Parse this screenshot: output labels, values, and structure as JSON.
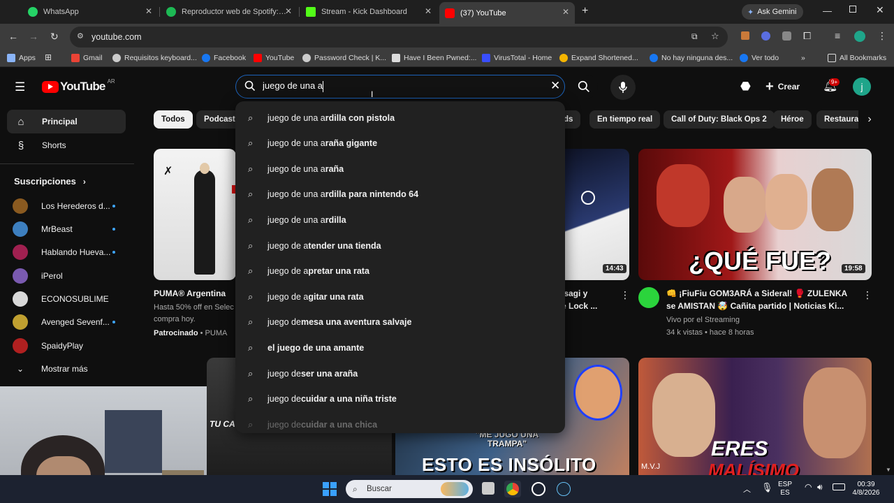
{
  "browser": {
    "tabs": [
      {
        "title": "WhatsApp",
        "fav_color": "#25d366"
      },
      {
        "title": "Reproductor web de Spotify: m",
        "fav_color": "#1db954"
      },
      {
        "title": "Stream - Kick Dashboard",
        "fav_color": "#53fc18"
      },
      {
        "title": "(37) YouTube",
        "fav_color": "#ff0000"
      }
    ],
    "ask_gemini": "Ask Gemini",
    "url": "youtube.com",
    "bookmarks": [
      {
        "label": "Apps"
      },
      {
        "label": "Gmail"
      },
      {
        "label": "Requisitos keyboard..."
      },
      {
        "label": "Facebook"
      },
      {
        "label": "YouTube"
      },
      {
        "label": "Password Check | K..."
      },
      {
        "label": "Have I Been Pwned:..."
      },
      {
        "label": "VirusTotal - Home"
      },
      {
        "label": "Expand Shortened..."
      },
      {
        "label": "No hay ninguna des..."
      },
      {
        "label": "Ver todo"
      }
    ],
    "all_bookmarks": "All Bookmarks"
  },
  "header": {
    "logo_text": "YouTube",
    "country": "AR",
    "search_value": "juego de una a",
    "create_label": "Crear",
    "notif_badge": "9+",
    "avatar_letter": "j"
  },
  "sidebar": {
    "principal": "Principal",
    "shorts": "Shorts",
    "subs_heading": "Suscripciones",
    "subs": [
      {
        "name": "Los Herederos d...",
        "color": "#8a5a20"
      },
      {
        "name": "MrBeast",
        "color": "#3d7fbf"
      },
      {
        "name": "Hablando Hueva...",
        "color": "#a02050"
      },
      {
        "name": "iPerol",
        "color": "#7a5ab0"
      },
      {
        "name": "ECONOSUBLIME",
        "color": "#d8d8d8"
      },
      {
        "name": "Avenged Sevenf...",
        "color": "#c0a030"
      },
      {
        "name": "SpaidyPlay",
        "color": "#b02020"
      }
    ],
    "show_more": "Mostrar más"
  },
  "chips": [
    "Todos",
    "Podcasts",
    "nds",
    "En tiempo real",
    "Call of Duty: Black Ops 2",
    "Héroe",
    "Restaurar"
  ],
  "suggestions": [
    {
      "typed": "juego de una a",
      "rest": "rdilla con pistola"
    },
    {
      "typed": "juego de una a",
      "rest": "raña gigante"
    },
    {
      "typed": "juego de una a",
      "rest": "raña"
    },
    {
      "typed": "juego de una a",
      "rest": "rdilla para nintendo 64"
    },
    {
      "typed": "juego de una a",
      "rest": "rdilla"
    },
    {
      "typed": "juego de a",
      "rest": "tender una tienda"
    },
    {
      "typed": "juego de a",
      "rest": "pretar una rata"
    },
    {
      "typed": "juego de a",
      "rest": "gitar una rata"
    },
    {
      "typed": "juego de ",
      "rest": "mesa una aventura salvaje"
    },
    {
      "typed": "",
      "rest": "el juego de una amante"
    },
    {
      "typed": "juego de ",
      "rest": "ser una araña"
    },
    {
      "typed": "juego de ",
      "rest": "cuidar a una niña triste"
    },
    {
      "typed": "juego de ",
      "rest": "cuidar a una chica"
    }
  ],
  "videos": {
    "ad": {
      "title": "PUMA® Argentina",
      "desc": "Hasta 50% off en Selec compra hoy.",
      "sponsored": "Patrocinado",
      "brand": "PUMA"
    },
    "v2": {
      "title_part1": "Isagi y",
      "title_part2": "e Lock ...",
      "duration": "14:43"
    },
    "v3": {
      "title": "👊 ¡FiuFiu GOM3ARÁ a Sideral! 🥊 ZULENKA se AMISTAN 🤯 Cañita partido | Noticias Ki...",
      "channel": "Vivo por el Streaming",
      "stats": "34 k vistas • hace 8 horas",
      "duration": "19:58",
      "overlay": "¿QUÉ FUE?"
    },
    "row2": {
      "left_text": "TU CA",
      "mid_text1": "\"ME JUGO UNA TRAMPA\"",
      "mid_text2": "ESTO ES INSÓLITO",
      "right_text1": "ERES",
      "right_text2": "MALÍSIMO",
      "right_tag": "M.V.J"
    }
  },
  "taskbar": {
    "search_placeholder": "Buscar",
    "lang1": "ESP",
    "lang2": "ES",
    "time": "00:39",
    "date": "4/8/2026"
  }
}
